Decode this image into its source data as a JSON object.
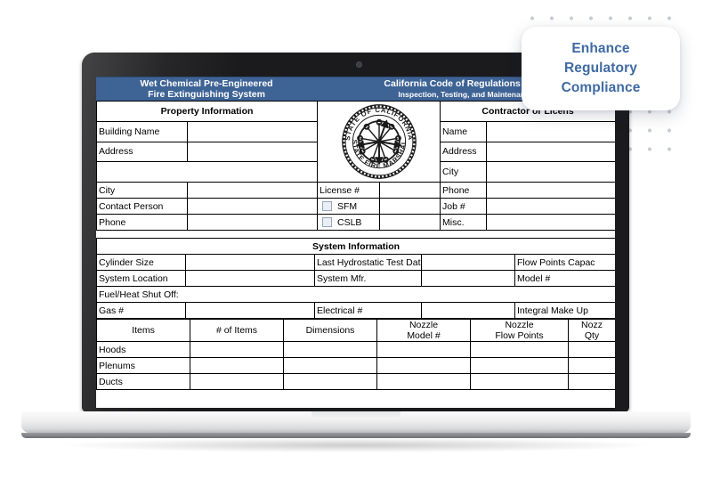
{
  "callout": {
    "line1": "Enhance",
    "line2": "Regulatory",
    "line3": "Compliance",
    "accent_color": "#3f6ba3"
  },
  "colors": {
    "header_blue": "#3e6395",
    "section_blue": "#4c7cb0",
    "column_header_blue": "#a9c0da",
    "field_fill": "#eef3fb",
    "border": "#000000"
  },
  "document": {
    "header": {
      "left_line1": "Wet Chemical Pre-Engineered",
      "left_line2": "Fire Extinguishing System",
      "right_line1": "California Code of Regulations - Title",
      "right_line2": "Inspection, Testing, and Maintenance"
    },
    "property_section": {
      "title": "Property Information",
      "rows": [
        {
          "label": "Building Name",
          "value": ""
        },
        {
          "label": "Address",
          "value": ""
        },
        {
          "label": "",
          "value": ""
        },
        {
          "label": "City",
          "value": ""
        },
        {
          "label": "Contact Person",
          "value": ""
        },
        {
          "label": "Phone",
          "value": ""
        }
      ]
    },
    "seal": {
      "top_text": "STATE OF CALIFORNIA",
      "bottom_text": "STATE FIRE MARSHAL"
    },
    "license_block": {
      "license_label": "License #",
      "license_value": "",
      "checkboxes": [
        {
          "label": "SFM",
          "checked": false
        },
        {
          "label": "CSLB",
          "checked": false
        }
      ]
    },
    "contractor_section": {
      "title": "Contractor or Licens",
      "rows": [
        {
          "label": "Name",
          "value": ""
        },
        {
          "label": "Address",
          "value": ""
        },
        {
          "label": "City",
          "value": ""
        },
        {
          "label": "Phone",
          "value": ""
        },
        {
          "label": "Job #",
          "value": ""
        },
        {
          "label": "Misc.",
          "value": ""
        }
      ]
    },
    "system_section": {
      "title": "System Information",
      "rows": [
        [
          {
            "label": "Cylinder Size",
            "value": ""
          },
          {
            "label": "Last Hydrostatic Test Date",
            "value": ""
          },
          {
            "label": "Flow Points Capac",
            "value": ""
          }
        ],
        [
          {
            "label": "System Location",
            "value": ""
          },
          {
            "label": "System Mfr.",
            "value": ""
          },
          {
            "label": "Model #",
            "value": ""
          }
        ]
      ],
      "fuel_row": {
        "label": "Fuel/Heat Shut Off:",
        "value": ""
      },
      "last_row": [
        {
          "label": "Gas #",
          "value": ""
        },
        {
          "label": "Electrical #",
          "value": ""
        },
        {
          "label": "Integral Make Up",
          "value": ""
        }
      ]
    },
    "items_table": {
      "columns": [
        "Items",
        "# of Items",
        "Dimensions",
        "Nozzle\nModel #",
        "Nozzle\nFlow Points",
        "Nozz\nQty"
      ],
      "column_lines": [
        [
          "Items",
          ""
        ],
        [
          "# of Items",
          ""
        ],
        [
          "Dimensions",
          ""
        ],
        [
          "Nozzle",
          "Model #"
        ],
        [
          "Nozzle",
          "Flow Points"
        ],
        [
          "Nozz",
          "Qty"
        ]
      ],
      "rows": [
        {
          "item": "Hoods",
          "count": "",
          "dimensions": "",
          "nozzle_model": "",
          "nozzle_flow_points": "",
          "nozzle_qty": ""
        },
        {
          "item": "Plenums",
          "count": "",
          "dimensions": "",
          "nozzle_model": "",
          "nozzle_flow_points": "",
          "nozzle_qty": ""
        },
        {
          "item": "Ducts",
          "count": "",
          "dimensions": "",
          "nozzle_model": "",
          "nozzle_flow_points": "",
          "nozzle_qty": ""
        }
      ]
    }
  }
}
